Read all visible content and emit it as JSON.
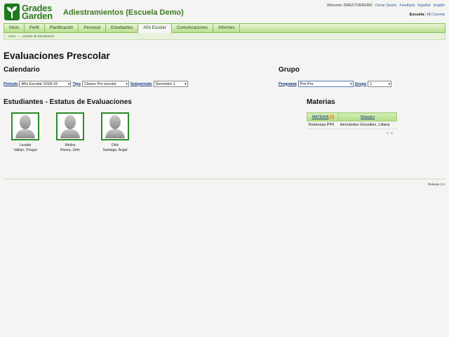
{
  "brand": {
    "line1": "Grades",
    "line2": "Garden",
    "color": "#2e7d1e"
  },
  "app_title": "Adiestramientos (Escuela Demo)",
  "top_links": {
    "welcome": "Welcome: DIRECTORDEMO",
    "logout": "Cerrar Sesión",
    "feedback": "Feedback",
    "spanish": "Español",
    "english": "English"
  },
  "context_switch": {
    "current": "Escuela",
    "separator": "|",
    "other": "Mi Cuenta"
  },
  "nav": {
    "tabs": [
      "Inicio",
      "Perfil",
      "Planificación",
      "Personal",
      "Estudiantes",
      "Año Escolar",
      "Comunicaciones",
      "Informes"
    ],
    "active": "Año Escolar"
  },
  "breadcrumb": {
    "home": "Inicio",
    "sep": ">",
    "current": "Listado de Estudiantes"
  },
  "page_title": "Evaluaciones Prescolar",
  "calendario": {
    "heading": "Calendario",
    "periodo_label": "Periodo",
    "periodo_value": "Año Escolar 2018-19",
    "tipo_label": "Tipo",
    "tipo_value": "Clases Pre escolar",
    "subperiodo_label": "Subperiodo",
    "subperiodo_value": "Semestre 1"
  },
  "grupo": {
    "heading": "Grupo",
    "programa_label": "Programa",
    "programa_value": "Pre-Pre",
    "grupo_label": "Grupo",
    "grupo_value": "1"
  },
  "students_heading": "Estudiantes - Estatus de Evaluaciones",
  "students": [
    {
      "line1": "Lozada",
      "line2": "Vallejo, Chagui"
    },
    {
      "line1": "Molina",
      "line2": "Rivera, John"
    },
    {
      "line1": "Ortiz",
      "line2": "Santiago, Angel"
    }
  ],
  "materias": {
    "heading": "Materias",
    "columns": [
      "MATERIA",
      "Maestro"
    ],
    "rows": [
      [
        "Destrezas PP0",
        "Hernández González, Liliana"
      ]
    ],
    "pager": "1 - 1"
  },
  "release": "Release 3.3"
}
